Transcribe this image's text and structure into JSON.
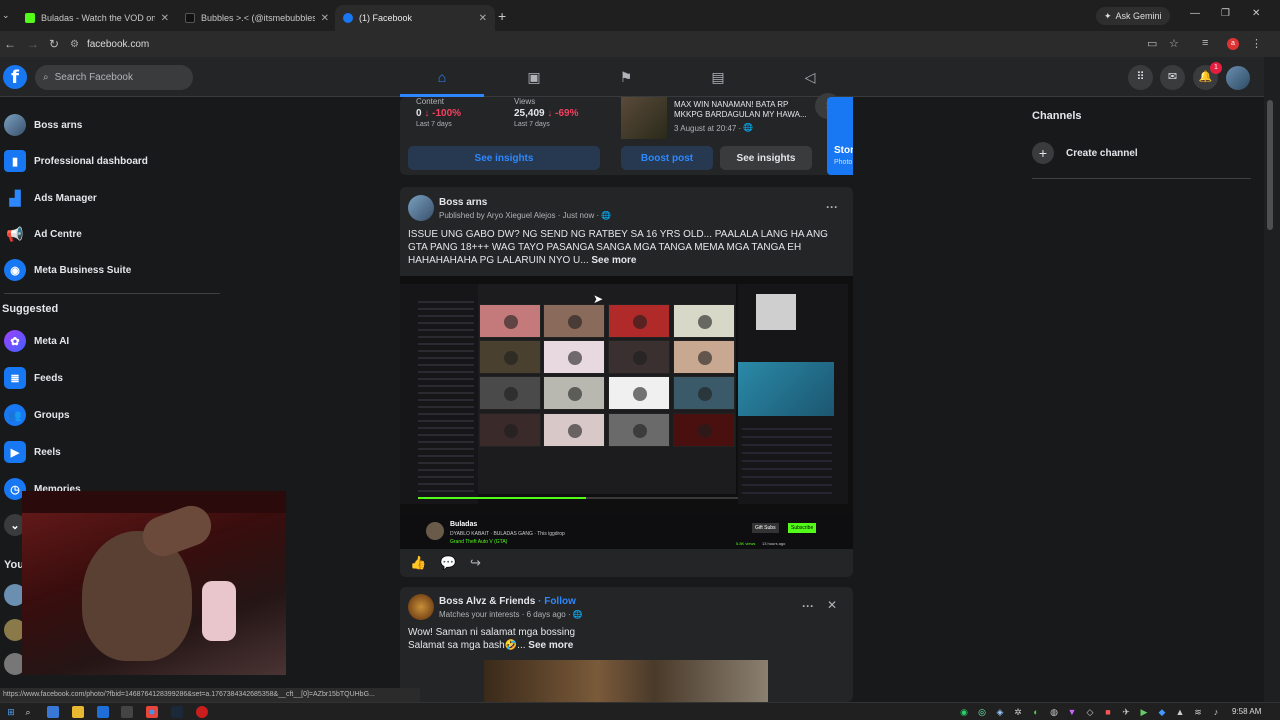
{
  "browser": {
    "tabs": [
      {
        "title": "Buladas - Watch the VOD on Ki",
        "favicon_color": "#53fc18"
      },
      {
        "title": "Bubbles >.< (@itsmebubbles.a",
        "favicon_color": "#111111"
      },
      {
        "title": "(1) Facebook",
        "favicon_color": "#1877f2"
      }
    ],
    "ask_gemini": "Ask Gemini",
    "url": "facebook.com",
    "extension_badge": "a"
  },
  "fb_header": {
    "search_placeholder": "Search Facebook",
    "notification_count": "1"
  },
  "sidebar": {
    "items": [
      {
        "label": "Boss arns",
        "icon": "profile-avatar"
      },
      {
        "label": "Professional dashboard",
        "icon": "dashboard-icon"
      },
      {
        "label": "Ads Manager",
        "icon": "ads-chart-icon"
      },
      {
        "label": "Ad Centre",
        "icon": "megaphone-icon"
      },
      {
        "label": "Meta Business Suite",
        "icon": "business-suite-icon"
      }
    ],
    "suggested_heading": "Suggested",
    "suggested": [
      {
        "label": "Meta AI",
        "icon": "meta-ai-icon"
      },
      {
        "label": "Feeds",
        "icon": "feeds-icon"
      },
      {
        "label": "Groups",
        "icon": "groups-icon"
      },
      {
        "label": "Reels",
        "icon": "reels-icon"
      },
      {
        "label": "Memories",
        "icon": "memories-icon"
      }
    ],
    "your_heading_partial": "You"
  },
  "insights": {
    "content": {
      "label": "Content",
      "value": "0",
      "change": "↓ -100%",
      "period": "Last 7 days"
    },
    "views": {
      "label": "Views",
      "value": "25,409",
      "change": "↓ -69%",
      "period": "Last 7 days"
    },
    "see_insights": "See insights",
    "recent_post": {
      "title": "MAX WIN NANAMAN! BATA RP MKKPG BARDAGULAN MY HAWA...",
      "date": "3 August at 20:47 ·"
    },
    "boost_post": "Boost post",
    "see_insights_2": "See insights",
    "story_title": "Stor",
    "story_sub": "Photo"
  },
  "post1": {
    "author": "Boss arns",
    "published_by": "Published by Aryo Xieguel Alejos",
    "time": "· Just now ·",
    "text": "ISSUE UNG GABO DW? NG SEND NG RATBEY SA 16 YRS OLD... PAALALA LANG HA ANG GTA PANG 18+++ WAG TAYO PASANGA SANGA MGA TANGA MEMA MGA TANGA EH HAHAHAHAHA PG LALARUIN NYO U...",
    "see_more": "See more",
    "more_options": "···",
    "image_channel": "Buladas",
    "image_channel_sub": "DYABLO KABAIT · BULADAS GANG · This iggdrop",
    "image_game": "Grand Theft Auto V (GTA)",
    "image_gift_subs": "Gift Subs",
    "image_subscribe": "Subscribe",
    "image_views": "5.8K views",
    "image_time": "13 hours ago"
  },
  "post2": {
    "author": "Boss Alvz & Friends",
    "follow": "· Follow",
    "meta": "Matches your interests · 6 days ago ·",
    "text_line1": "Wow! Saman ni salamat mga bossing",
    "text_line2": "Salamat sa mga bash🤣...",
    "see_more": "See more",
    "more_options": "···",
    "close": "✕"
  },
  "right_panel": {
    "heading": "Channels",
    "create_channel": "Create channel"
  },
  "status_url": "https://www.facebook.com/photo/?fbid=1468764128399286&set=a.1767384342685358&__cft__[0]=AZbr15bTQUHbG...",
  "taskbar": {
    "time": "9:58 AM"
  },
  "colors": {
    "fb_blue": "#1877f2",
    "link_blue": "#2d88ff",
    "negative_red": "#f3425f",
    "card_bg": "#242526"
  }
}
